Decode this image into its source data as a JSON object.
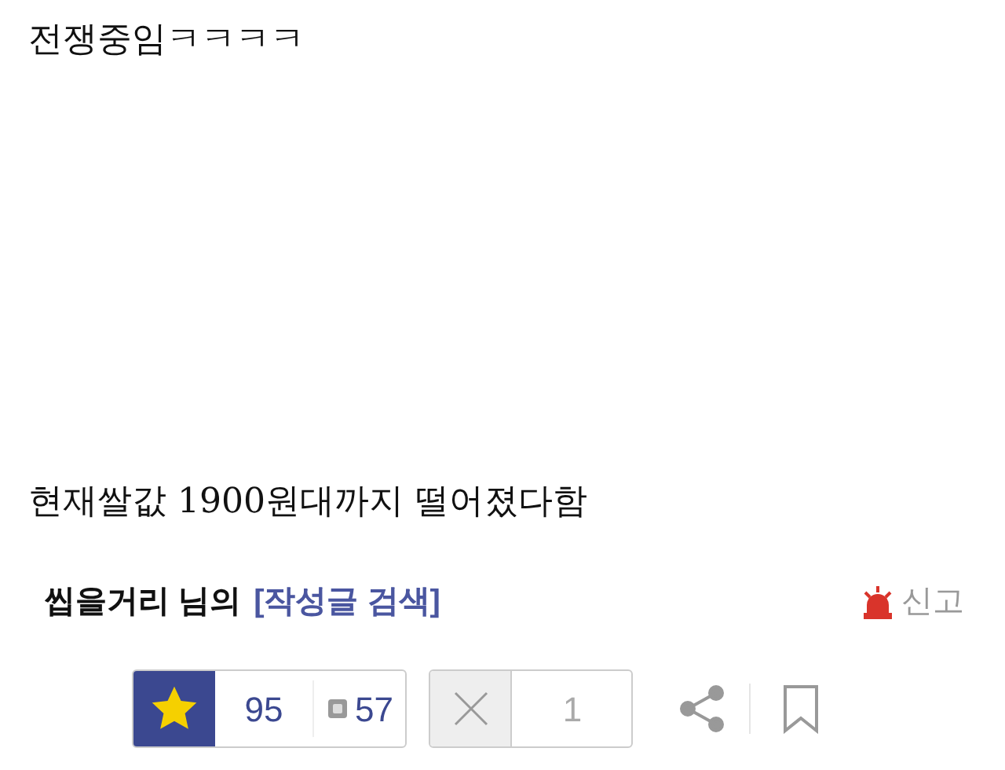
{
  "post": {
    "title": "전쟁중임ㅋㅋㅋㅋ",
    "body": "현재쌀값 1900원대까지 떨어졌다함"
  },
  "author": {
    "name": "씹을거리 님의",
    "search_link": "[작성글 검색]",
    "report": "신고"
  },
  "actions": {
    "upvotes": "95",
    "best_count": "57",
    "downvotes": "1"
  }
}
